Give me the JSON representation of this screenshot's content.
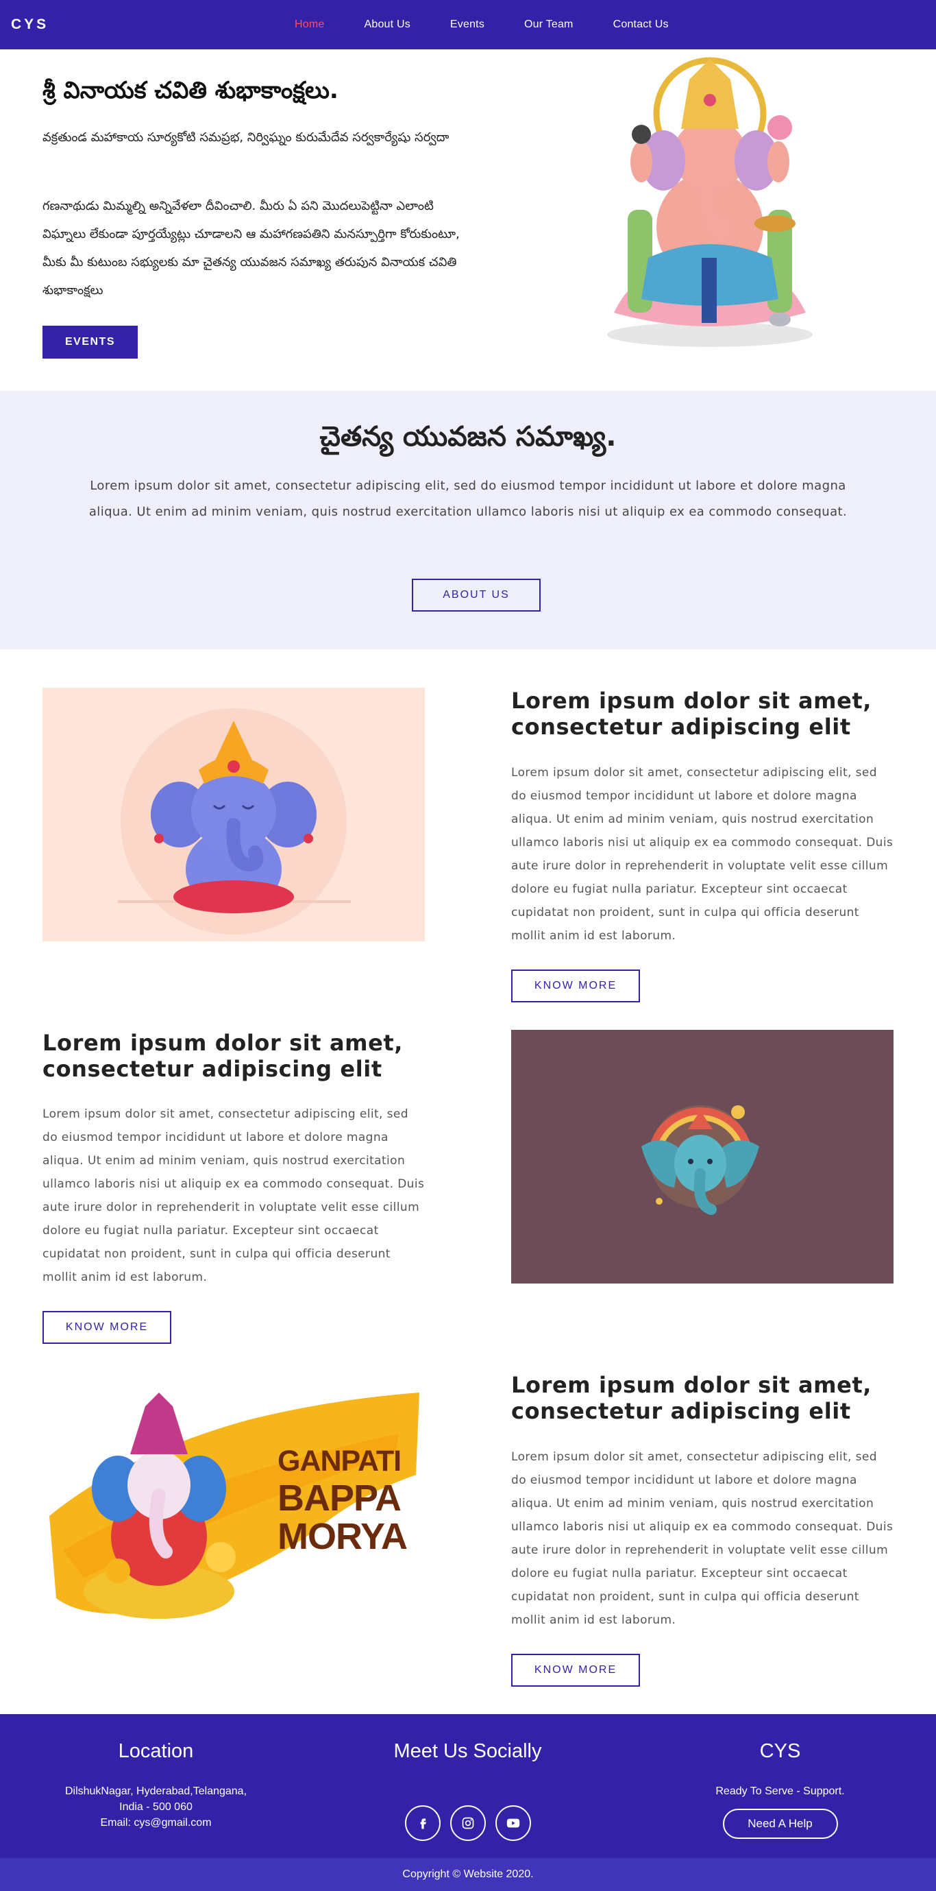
{
  "nav": {
    "brand": "CYS",
    "items": [
      {
        "label": "Home",
        "active": true
      },
      {
        "label": "About Us",
        "active": false
      },
      {
        "label": "Events",
        "active": false
      },
      {
        "label": "Our Team",
        "active": false
      },
      {
        "label": "Contact Us",
        "active": false
      }
    ]
  },
  "hero": {
    "title": "శ్రీ వినాయక చవితి శుభాకాంక్షలు.",
    "subtitle": "వక్రతుండ మహాకాయ సూర్యకోటి సమప్రభ, నిర్విఘ్నం కురుమేదేవ సర్వకార్యేషు సర్వదా",
    "body": "గణనాథుడు మిమ్మల్ని అన్నివేళలా దీవించాలి. మీరు ఏ పని మొదలుపెట్టినా ఎలాంటి విఘ్నాలు లేకుండా పూర్తయ్యేట్లు చూడాలని ఆ మహాగణపతిని మనస్పూర్తిగా కోరుకుంటూ, మీకు మీ కుటుంబ సభ్యులకు మా చైతన్య యువజన సమాఖ్య తరుపున వినాయక చవితి శుభాకాంక్షలు",
    "button": "EVENTS"
  },
  "about": {
    "title": "చైతన్య యువజన సమాఖ్య.",
    "text": "Lorem ipsum dolor sit amet, consectetur adipiscing elit, sed do eiusmod tempor incididunt ut labore et dolore magna aliqua. Ut enim ad minim veniam, quis nostrud exercitation ullamco laboris nisi ut aliquip ex ea commodo consequat.",
    "button": "ABOUT US"
  },
  "features": [
    {
      "title": "Lorem ipsum dolor sit amet, consectetur adipiscing elit",
      "text": "Lorem ipsum dolor sit amet, consectetur adipiscing elit, sed do eiusmod tempor incididunt ut labore et dolore magna aliqua. Ut enim ad minim veniam, quis nostrud exercitation ullamco laboris nisi ut aliquip ex ea commodo consequat. Duis aute irure dolor in reprehenderit in voluptate velit esse cillum dolore eu fugiat nulla pariatur. Excepteur sint occaecat cupidatat non proident, sunt in culpa qui officia deserunt mollit anim id est laborum.",
      "button": "KNOW MORE"
    },
    {
      "title": "Lorem ipsum dolor sit amet, consectetur adipiscing elit",
      "text": "Lorem ipsum dolor sit amet, consectetur adipiscing elit, sed do eiusmod tempor incididunt ut labore et dolore magna aliqua. Ut enim ad minim veniam, quis nostrud exercitation ullamco laboris nisi ut aliquip ex ea commodo consequat. Duis aute irure dolor in reprehenderit in voluptate velit esse cillum dolore eu fugiat nulla pariatur. Excepteur sint occaecat cupidatat non proident, sunt in culpa qui officia deserunt mollit anim id est laborum.",
      "button": "KNOW MORE"
    },
    {
      "title": "Lorem ipsum dolor sit amet, consectetur adipiscing elit",
      "text": "Lorem ipsum dolor sit amet, consectetur adipiscing elit, sed do eiusmod tempor incididunt ut labore et dolore magna aliqua. Ut enim ad minim veniam, quis nostrud exercitation ullamco laboris nisi ut aliquip ex ea commodo consequat. Duis aute irure dolor in reprehenderit in voluptate velit esse cillum dolore eu fugiat nulla pariatur. Excepteur sint occaecat cupidatat non proident, sunt in culpa qui officia deserunt mollit anim id est laborum.",
      "button": "KNOW MORE",
      "image_text": [
        "GANPATI",
        "BAPPA",
        "MORYA"
      ]
    }
  ],
  "footer": {
    "location": {
      "title": "Location",
      "address_line1": "DilshukNagar, Hyderabad,Telangana,",
      "address_line2": "India - 500 060",
      "email": "Email: cys@gmail.com"
    },
    "social": {
      "title": "Meet Us Socially",
      "icons": [
        "facebook-icon",
        "instagram-icon",
        "youtube-icon"
      ]
    },
    "brand": {
      "title": "CYS",
      "tagline": "Ready To Serve - Support.",
      "button": "Need A Help"
    },
    "copyright": "Copyright © Website 2020."
  },
  "colors": {
    "primary": "#3322a8",
    "active_link": "#ff4d6d",
    "band_bg": "#efeefb"
  }
}
